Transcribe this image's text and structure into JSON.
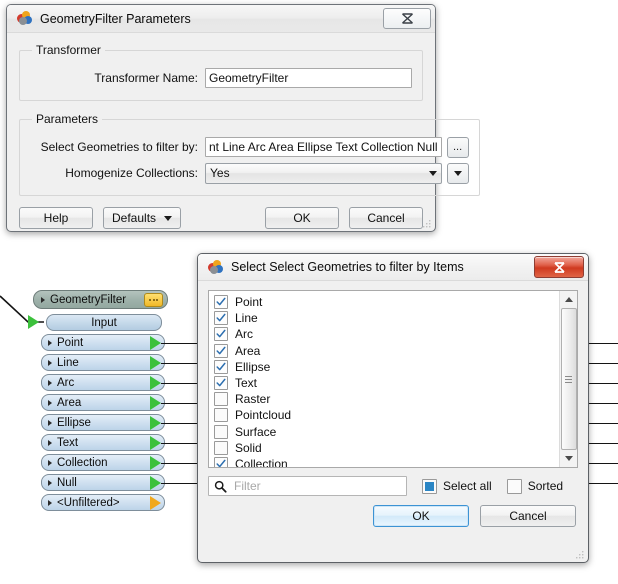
{
  "dialog1": {
    "title": "GeometryFilter Parameters",
    "icon": "fme-transformer-icon",
    "close_label": "Close",
    "groups": {
      "transformer": {
        "legend": "Transformer",
        "name_label": "Transformer Name:",
        "name_value": "GeometryFilter"
      },
      "parameters": {
        "legend": "Parameters",
        "geometries_label": "Select Geometries to filter by:",
        "geometries_value": "nt Line Arc Area Ellipse Text Collection Null",
        "geometries_browse": "...",
        "homogenize_label": "Homogenize Collections:",
        "homogenize_value": "Yes"
      }
    },
    "buttons": {
      "help": "Help",
      "defaults": "Defaults",
      "ok": "OK",
      "cancel": "Cancel"
    }
  },
  "graph": {
    "node_title": "GeometryFilter",
    "menu_badge": "...",
    "input_port": "Input",
    "output_ports": [
      {
        "label": "Point",
        "connected": true
      },
      {
        "label": "Line",
        "connected": true
      },
      {
        "label": "Arc",
        "connected": true
      },
      {
        "label": "Area",
        "connected": true
      },
      {
        "label": "Ellipse",
        "connected": true
      },
      {
        "label": "Text",
        "connected": true
      },
      {
        "label": "Collection",
        "connected": true
      },
      {
        "label": "Null",
        "connected": true
      },
      {
        "label": "<Unfiltered>",
        "connected": false
      }
    ]
  },
  "dialog2": {
    "title": "Select Select Geometries to filter by Items",
    "icon": "fme-transformer-icon",
    "close_label": "Close",
    "items": [
      {
        "label": "Point",
        "checked": true
      },
      {
        "label": "Line",
        "checked": true
      },
      {
        "label": "Arc",
        "checked": true
      },
      {
        "label": "Area",
        "checked": true
      },
      {
        "label": "Ellipse",
        "checked": true
      },
      {
        "label": "Text",
        "checked": true
      },
      {
        "label": "Raster",
        "checked": false
      },
      {
        "label": "Pointcloud",
        "checked": false
      },
      {
        "label": "Surface",
        "checked": false
      },
      {
        "label": "Solid",
        "checked": false
      },
      {
        "label": "Collection",
        "checked": true
      }
    ],
    "filter_placeholder": "Filter",
    "filter_value": "",
    "select_all_label": "Select all",
    "select_all_state": "partial",
    "sorted_label": "Sorted",
    "sorted_state": "unchecked",
    "buttons": {
      "ok": "OK",
      "cancel": "Cancel"
    }
  },
  "colors": {
    "accent_blue": "#2b86c5",
    "node_header": "#9fb2ab",
    "port_blue": "#cfe0f0",
    "port_connected": "#3cc13c",
    "port_unconnected": "#f0a81e",
    "badge_orange": "#f0b828",
    "close_red": "#cf3a20"
  }
}
